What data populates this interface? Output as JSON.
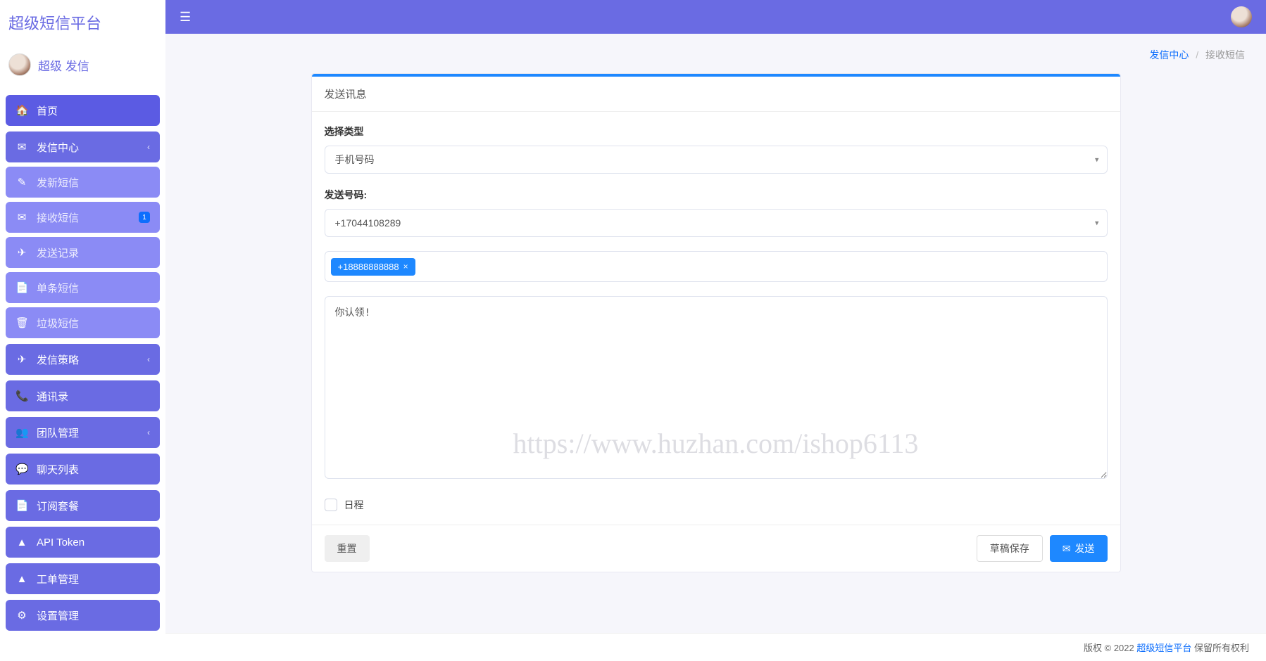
{
  "brand": "超级短信平台",
  "user_name": "超级 发信",
  "sidebar": {
    "home": "首页",
    "send_center": "发信中心",
    "send_center_children": [
      {
        "icon": "✎",
        "label": "发新短信"
      },
      {
        "icon": "✉",
        "label": "接收短信",
        "badge": "1"
      },
      {
        "icon": "✈",
        "label": "发送记录"
      },
      {
        "icon": "📄",
        "label": "单条短信"
      },
      {
        "icon": "🗑",
        "label": "垃圾短信"
      }
    ],
    "send_policy": "发信策略",
    "contacts": "通讯录",
    "team": "团队管理",
    "chat_list": "聊天列表",
    "billing": "订阅套餐",
    "api_token": "API Token",
    "tickets": "工单管理",
    "settings": "设置管理"
  },
  "breadcrumb": {
    "parent": "发信中心",
    "current": "接收短信"
  },
  "card": {
    "title": "发送讯息",
    "type_label": "选择类型",
    "type_value": "手机号码",
    "from_label": "发送号码:",
    "from_value": "+17044108289",
    "recipient_tag": "+18888888888",
    "message_value": "你认领!",
    "schedule_label": "日程",
    "reset": "重置",
    "save_draft": "草稿保存",
    "send": "发送"
  },
  "footer": {
    "prefix": "版权 © 2022 ",
    "brand": "超级短信平台",
    "suffix": " 保留所有权利"
  },
  "watermark": "https://www.huzhan.com/ishop6113"
}
